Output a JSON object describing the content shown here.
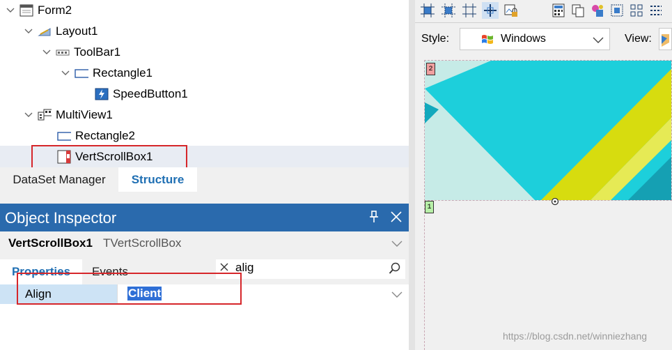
{
  "structure": {
    "items": [
      {
        "label": "Form2",
        "icon": "form-icon",
        "expanded": true
      },
      {
        "label": "Layout1",
        "icon": "layout-icon",
        "expanded": true
      },
      {
        "label": "ToolBar1",
        "icon": "toolbar-icon",
        "expanded": true
      },
      {
        "label": "Rectangle1",
        "icon": "rectangle-icon",
        "expanded": true
      },
      {
        "label": "SpeedButton1",
        "icon": "speedbutton-icon"
      },
      {
        "label": "MultiView1",
        "icon": "multiview-icon",
        "expanded": true
      },
      {
        "label": "Rectangle2",
        "icon": "rectangle-icon"
      },
      {
        "label": "VertScrollBox1",
        "icon": "vertscrollbox-icon",
        "selected": true
      }
    ],
    "tabs": {
      "dataset": "DataSet Manager",
      "structure": "Structure"
    }
  },
  "inspector": {
    "title": "Object Inspector",
    "object_name": "VertScrollBox1",
    "object_class": "TVertScrollBox",
    "tabs": {
      "properties": "Properties",
      "events": "Events"
    },
    "search_text": "alig",
    "property": {
      "name": "Align",
      "value": "Client"
    }
  },
  "designer": {
    "style_label": "Style:",
    "style_value": "Windows",
    "view_label": "View:",
    "marker_top": "2",
    "marker_bottom": "1"
  },
  "watermark": "https://blog.csdn.net/winniezhang",
  "colors": {
    "accent": "#2a6aad",
    "highlight_box": "#d6262a",
    "selection": "#2f6fd6",
    "canvas_teal": "#1dcfdb",
    "canvas_lime": "#d7dc0f"
  }
}
